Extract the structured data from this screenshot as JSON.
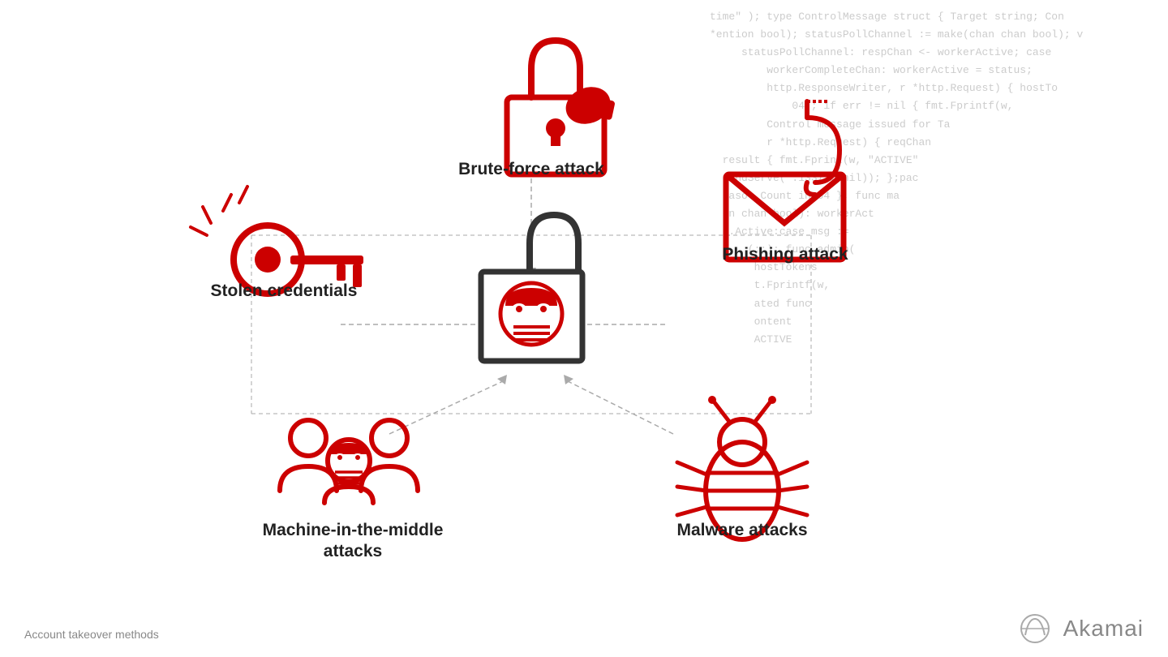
{
  "page": {
    "title": "Account takeover methods",
    "background_code": "time\" ); type ControlMessage struct { Target string; Con\n*ention bool); statusPollChannel := make(chan chan bool); v\n     statusPollChannel: respChan <- workerActive; case\n         workerCompleteChan: workerActive = status;\n         http.ResponseWriter, r *http.Request) { hostTo\n             04); if err != nil { fmt.Fprintf(w,\n         Control message issued for Ta\n         r *http.Request) { reqChan\n  result { fmt.Fprint(w, \"ACTIVE\"\n  nAndServe(\":1337\", nil)); };pac\n  taso. Count int64 }; func ma\n  on chan bool): workerAct\n  r.Active:case msg :=\n      (;;); func admin(\n       hostTokens\n       t.Fprintf(w,\n       ated func\n       ontent\n       ACTIVE",
    "labels": {
      "brute_force": "Brute-force attack",
      "stolen_credentials": "Stolen credentials",
      "phishing_attack": "Phishing attack",
      "mitm": "Machine-in-the-middle\nattacks",
      "malware": "Malware attacks",
      "caption": "Account takeover methods",
      "akamai": "Akamai"
    },
    "colors": {
      "red": "#cc0000",
      "dark_red": "#c00000",
      "gray": "#999999",
      "light_gray": "#cccccc",
      "dark": "#222222"
    }
  }
}
